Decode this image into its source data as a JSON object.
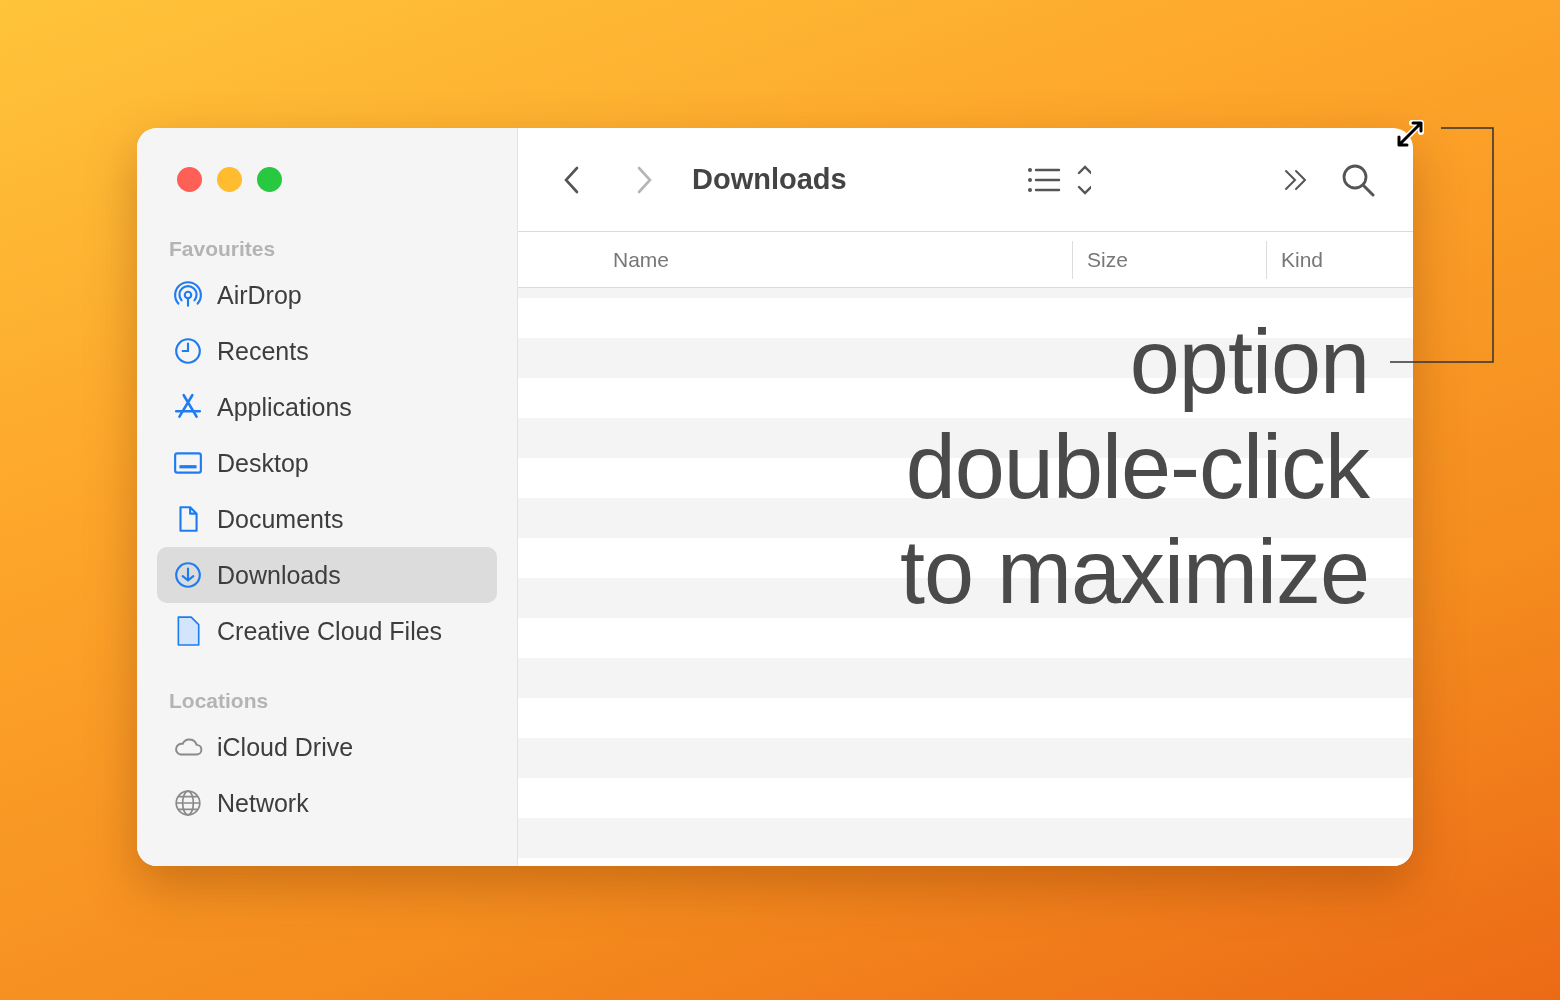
{
  "window": {
    "title": "Downloads"
  },
  "sidebar": {
    "sections": [
      {
        "heading": "Favourites",
        "items": [
          {
            "label": "AirDrop",
            "selected": false
          },
          {
            "label": "Recents",
            "selected": false
          },
          {
            "label": "Applications",
            "selected": false
          },
          {
            "label": "Desktop",
            "selected": false
          },
          {
            "label": "Documents",
            "selected": false
          },
          {
            "label": "Downloads",
            "selected": true
          },
          {
            "label": "Creative Cloud Files",
            "selected": false
          }
        ]
      },
      {
        "heading": "Locations",
        "items": [
          {
            "label": "iCloud Drive",
            "selected": false
          },
          {
            "label": "Network",
            "selected": false
          }
        ]
      }
    ]
  },
  "table": {
    "columns": [
      "Name",
      "Size",
      "Kind"
    ]
  },
  "annotation": {
    "lines": [
      "option",
      "double-click",
      "to maximize"
    ]
  }
}
